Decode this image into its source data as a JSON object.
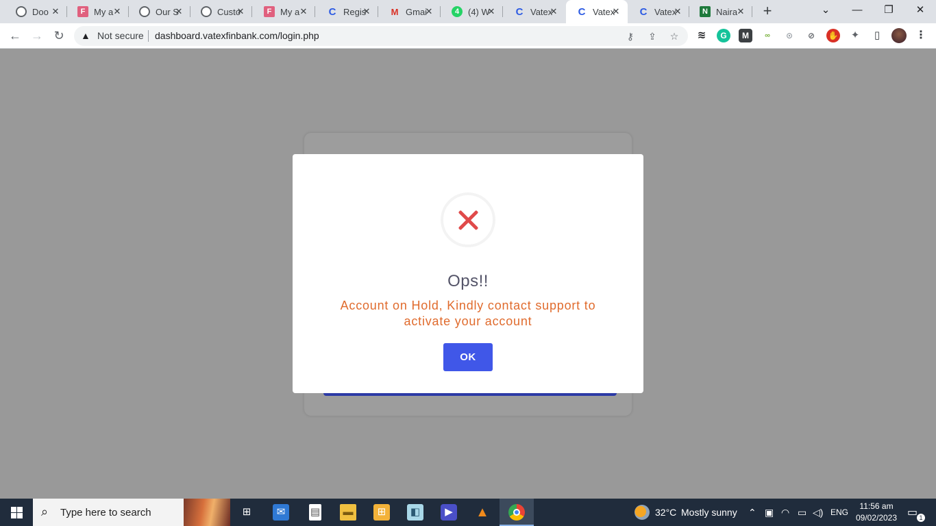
{
  "browser": {
    "tabs": [
      {
        "title": "Doo",
        "icon": "globe-icon",
        "color": "#5f6368",
        "glyph": ""
      },
      {
        "title": "My a",
        "icon": "f-form-icon",
        "color": "#e0607e",
        "glyph": "F"
      },
      {
        "title": "Our S",
        "icon": "globe-icon",
        "color": "#5f6368",
        "glyph": ""
      },
      {
        "title": "Custo",
        "icon": "globe-icon",
        "color": "#5f6368",
        "glyph": ""
      },
      {
        "title": "My a",
        "icon": "f-form-icon",
        "color": "#e0607e",
        "glyph": "F"
      },
      {
        "title": "Regis",
        "icon": "vatex-c-icon",
        "color": "#2d5be3",
        "glyph": "C"
      },
      {
        "title": "Gmai",
        "icon": "gmail-icon",
        "color": "#d93025",
        "glyph": "M"
      },
      {
        "title": "(4) W",
        "icon": "whatsapp-icon",
        "color": "#25d366",
        "glyph": "4"
      },
      {
        "title": "Vatex",
        "icon": "vatex-c-icon",
        "color": "#2d5be3",
        "glyph": "C"
      },
      {
        "title": "Vatex",
        "icon": "vatex-c-icon",
        "color": "#2d5be3",
        "glyph": "C",
        "active": true
      },
      {
        "title": "Vatex",
        "icon": "vatex-c-icon",
        "color": "#2d5be3",
        "glyph": "C"
      },
      {
        "title": "Naira",
        "icon": "naira-icon",
        "color": "#1e7a3c",
        "glyph": "N"
      }
    ],
    "new_tab_glyph": "+",
    "tab_search_glyph": "⌄",
    "minimize_glyph": "—",
    "restore_glyph": "❐",
    "close_glyph": "✕",
    "security_warning": "Not secure",
    "url": "dashboard.vatexfinbank.com/login.php"
  },
  "modal": {
    "title": "Ops!!",
    "message": "Account on Hold, Kindly contact support to activate your account",
    "ok_label": "OK",
    "accent_color": "#4057e8",
    "message_color": "#e06b2d",
    "error_color": "#e04a4a"
  },
  "taskbar": {
    "search_placeholder": "Type here to search",
    "weather_temp": "32°C",
    "weather_text": "Mostly sunny",
    "language": "ENG",
    "time": "11:56 am",
    "date": "09/02/2023",
    "notification_count": "1"
  }
}
